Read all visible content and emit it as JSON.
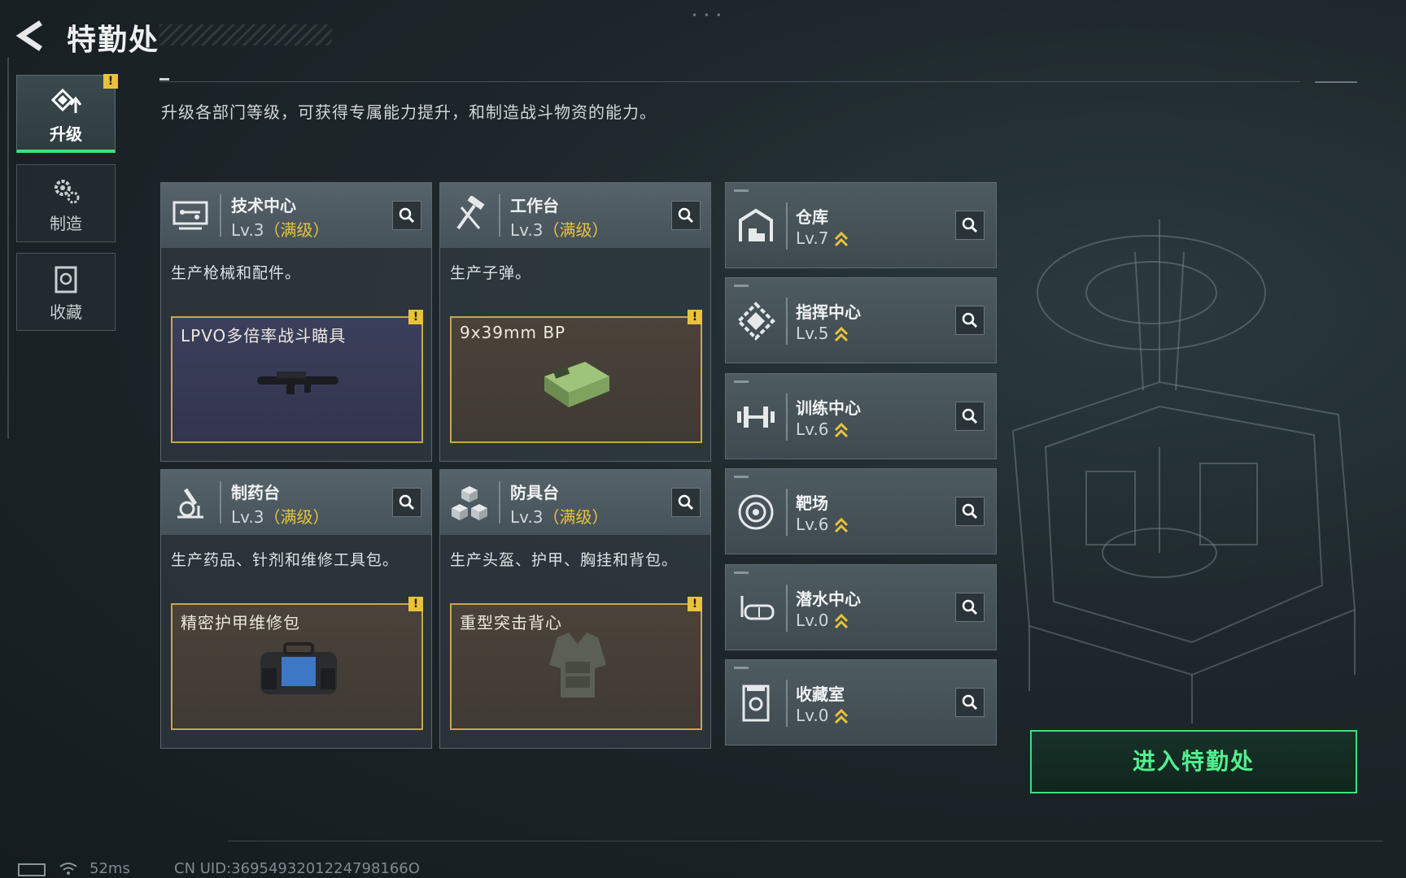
{
  "header": {
    "title": "特勤处",
    "back_icon": "back-arrow-icon"
  },
  "sidebar": {
    "items": [
      {
        "label": "升级",
        "icon": "upgrade-icon",
        "active": true,
        "alert": "!"
      },
      {
        "label": "制造",
        "icon": "gears-icon",
        "active": false
      },
      {
        "label": "收藏",
        "icon": "collection-icon",
        "active": false
      }
    ]
  },
  "description": "升级各部门等级，可获得专属能力提升，和制造战斗物资的能力。",
  "facilities": [
    {
      "name": "技术中心",
      "level": "Lv.3",
      "max": "（满级）",
      "desc": "生产枪械和配件。",
      "item": "LPVO多倍率战斗瞄具",
      "item_bg": "purple",
      "alert": "!"
    },
    {
      "name": "工作台",
      "level": "Lv.3",
      "max": "（满级）",
      "desc": "生产子弹。",
      "item": "9x39mm BP",
      "item_bg": "brown",
      "alert": "!"
    },
    {
      "name": "制药台",
      "level": "Lv.3",
      "max": "（满级）",
      "desc": "生产药品、针剂和维修工具包。",
      "item": "精密护甲维修包",
      "item_bg": "brown",
      "alert": "!"
    },
    {
      "name": "防具台",
      "level": "Lv.3",
      "max": "（满级）",
      "desc": "生产头盔、护甲、胸挂和背包。",
      "item": "重型突击背心",
      "item_bg": "brown",
      "alert": "!"
    }
  ],
  "departments": [
    {
      "name": "仓库",
      "level": "Lv.7"
    },
    {
      "name": "指挥中心",
      "level": "Lv.5"
    },
    {
      "name": "训练中心",
      "level": "Lv.6"
    },
    {
      "name": "靶场",
      "level": "Lv.6"
    },
    {
      "name": "潜水中心",
      "level": "Lv.0"
    },
    {
      "name": "收藏室",
      "level": "Lv.0"
    }
  ],
  "enter_button": "进入特勤处",
  "status": {
    "ping": "52ms",
    "uid": "CN UID:3695493201224798166O"
  },
  "colors": {
    "accent_green": "#3ee07a",
    "warning_yellow": "#e8c33a",
    "max_level": "#e8c33a"
  }
}
